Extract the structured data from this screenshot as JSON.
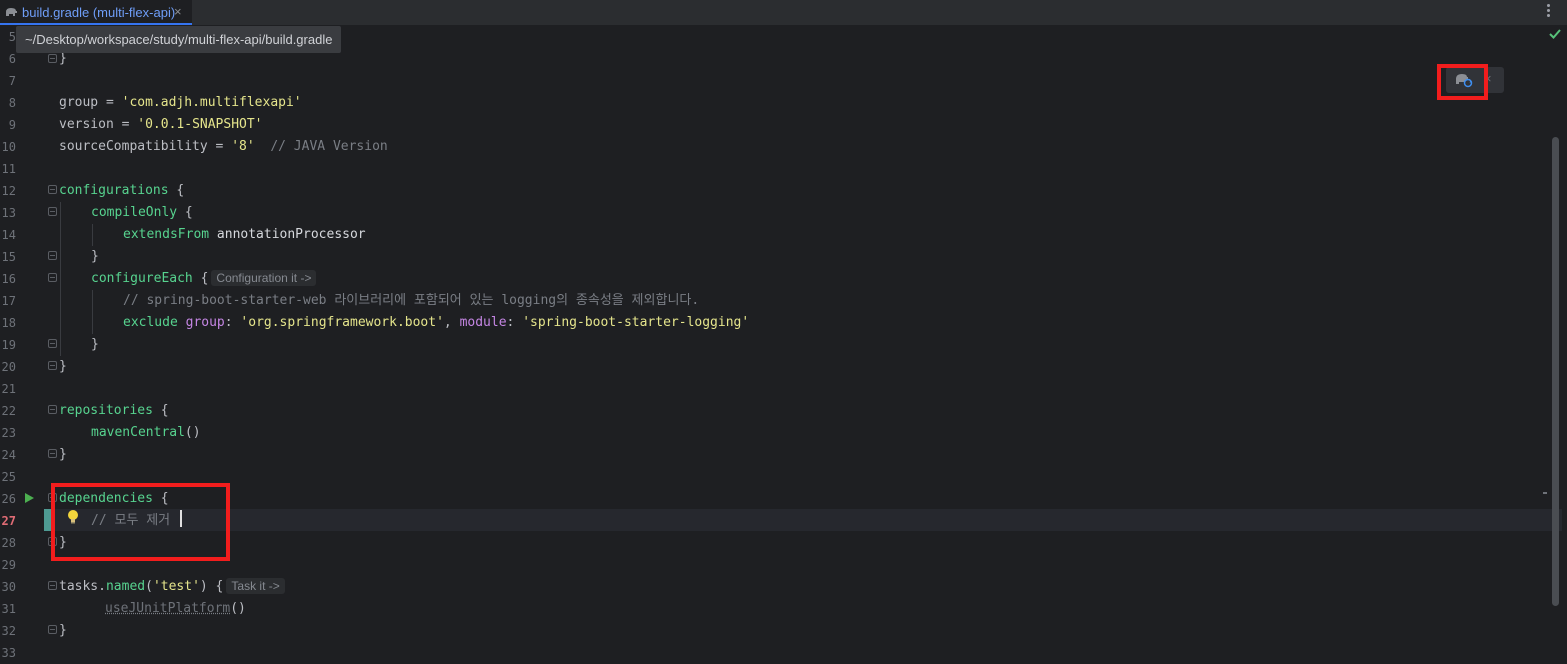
{
  "tab": {
    "title": "build.gradle (multi-flex-api)",
    "close": "×",
    "icon": "gradle-elephant-icon"
  },
  "tooltip": {
    "path": "~/Desktop/workspace/study/multi-flex-api/build.gradle"
  },
  "gradle_popup": {
    "icon": "gradle-reload-icon",
    "close": "×"
  },
  "gutter": {
    "line_numbers": [
      "5",
      "6",
      "7",
      "8",
      "9",
      "10",
      "11",
      "12",
      "13",
      "14",
      "15",
      "16",
      "17",
      "18",
      "19",
      "20",
      "21",
      "22",
      "23",
      "24",
      "25",
      "26",
      "27",
      "28",
      "29",
      "30",
      "31",
      "32",
      "33"
    ],
    "current_line": "27"
  },
  "code": {
    "l6": "}",
    "l8_a": "group = ",
    "l8_b": "'com.adjh.multiflexapi'",
    "l9_a": "version = ",
    "l9_b": "'0.0.1-SNAPSHOT'",
    "l10_a": "sourceCompatibility = ",
    "l10_b": "'8'",
    "l10_c": "  // JAVA Version",
    "l12_a": "configurations",
    "l12_b": " {",
    "l13_a": "compileOnly",
    "l13_b": " {",
    "l14_a": "extendsFrom",
    "l14_b": " annotationProcessor",
    "l15": "}",
    "l16_a": "configureEach",
    "l16_b": " {",
    "l16_hint": "Configuration it ->",
    "l17": "// spring-boot-starter-web 라이브러리에 포함되어 있는 logging의 종속성을 제외합니다.",
    "l18_a": "exclude ",
    "l18_b": "group",
    "l18_c": ": ",
    "l18_d": "'org.springframework.boot'",
    "l18_e": ", ",
    "l18_f": "module",
    "l18_g": ": ",
    "l18_h": "'spring-boot-starter-logging'",
    "l19": "}",
    "l20": "}",
    "l22_a": "repositories",
    "l22_b": " {",
    "l23_a": "mavenCentral",
    "l23_b": "()",
    "l24": "}",
    "l26_a": "dependencies",
    "l26_b": " {",
    "l27": "// 모두 제거 ",
    "l28": "}",
    "l30_a": "tasks.",
    "l30_b": "named",
    "l30_c": "(",
    "l30_d": "'test'",
    "l30_e": ") {",
    "l30_hint": "Task it ->",
    "l31_a": "useJUnitPlatform",
    "l31_b": "()",
    "l32": "}"
  },
  "colors": {
    "background": "#1e1f22",
    "keyword_green": "#57d38f",
    "string_yellow": "#e5e58c",
    "comment_gray": "#7a7e85",
    "named_param_purple": "#c586e4",
    "highlight_red": "#f21d1d"
  }
}
